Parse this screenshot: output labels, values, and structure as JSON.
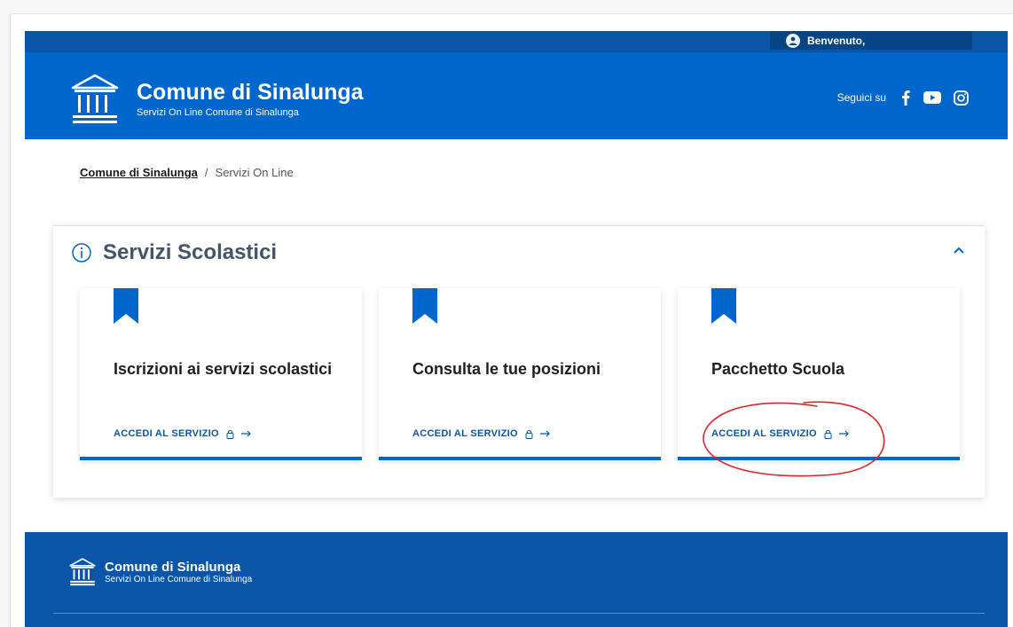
{
  "header": {
    "user_greeting": "Benvenuto,",
    "title": "Comune di Sinalunga",
    "subtitle": "Servizi On Line Comune di Sinalunga",
    "follow_label": "Seguici su",
    "social_icons": [
      "facebook-icon",
      "youtube-icon",
      "instagram-icon"
    ]
  },
  "breadcrumb": {
    "home": "Comune di Sinalunga",
    "separator": "/",
    "current": "Servizi On Line"
  },
  "section": {
    "title": "Servizi Scolastici",
    "cards": [
      {
        "title": "Iscrizioni ai servizi scolastici",
        "link": "ACCEDI AL SERVIZIO"
      },
      {
        "title": "Consulta le tue posizioni",
        "link": "ACCEDI AL SERVIZIO"
      },
      {
        "title": "Pacchetto Scuola",
        "link": "ACCEDI AL SERVIZIO"
      }
    ]
  },
  "footer": {
    "title": "Comune di Sinalunga",
    "subtitle": "Servizi On Line Comune di Sinalunga"
  },
  "colors": {
    "primary": "#0066cc",
    "dark_blue": "#0b55a8",
    "annotation_red": "#d9262a"
  }
}
